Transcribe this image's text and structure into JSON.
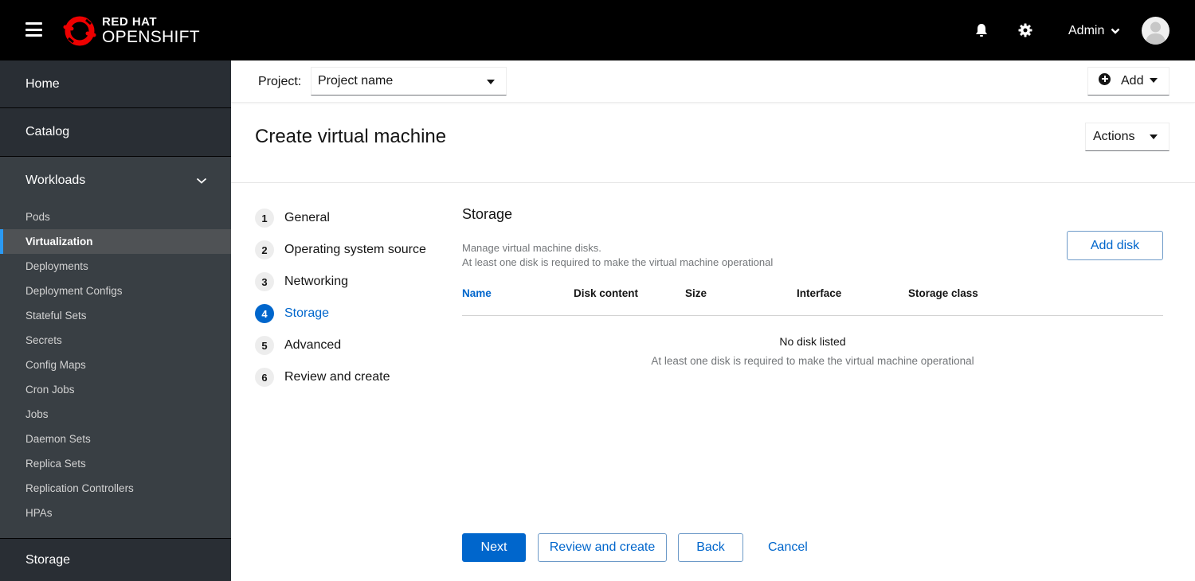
{
  "masthead": {
    "brand_line1": "RED HAT",
    "brand_line2": "OPENSHIFT",
    "user_label": "Admin",
    "icons": [
      "hamburger-icon",
      "openshift-logo-icon",
      "bell-icon",
      "gear-icon",
      "chevron-down-icon",
      "avatar-icon"
    ]
  },
  "sidebar": {
    "home": "Home",
    "catalog": "Catalog",
    "workloads": {
      "label": "Workloads",
      "expanded": true,
      "items": [
        {
          "label": "Pods",
          "active": false
        },
        {
          "label": "Virtualization",
          "active": true
        },
        {
          "label": "Deployments",
          "active": false
        },
        {
          "label": "Deployment Configs",
          "active": false
        },
        {
          "label": "Stateful Sets",
          "active": false
        },
        {
          "label": "Secrets",
          "active": false
        },
        {
          "label": "Config Maps",
          "active": false
        },
        {
          "label": "Cron Jobs",
          "active": false
        },
        {
          "label": "Jobs",
          "active": false
        },
        {
          "label": "Daemon Sets",
          "active": false
        },
        {
          "label": "Replica Sets",
          "active": false
        },
        {
          "label": "Replication Controllers",
          "active": false
        },
        {
          "label": "HPAs",
          "active": false
        }
      ]
    },
    "storage": "Storage"
  },
  "project_bar": {
    "label": "Project:",
    "selected": "Project name",
    "add_label": "Add"
  },
  "page": {
    "title": "Create virtual machine",
    "actions_label": "Actions"
  },
  "wizard": {
    "current_step": 4,
    "steps": [
      {
        "num": "1",
        "label": "General"
      },
      {
        "num": "2",
        "label": "Operating system source"
      },
      {
        "num": "3",
        "label": "Networking"
      },
      {
        "num": "4",
        "label": "Storage"
      },
      {
        "num": "5",
        "label": "Advanced"
      },
      {
        "num": "6",
        "label": "Review and create"
      }
    ]
  },
  "storage": {
    "title": "Storage",
    "desc_line1": "Manage virtual machine disks.",
    "desc_line2": "At least one disk is required to make the virtual machine operational",
    "add_disk_label": "Add disk",
    "columns": [
      "Name",
      "Disk content",
      "Size",
      "Interface",
      "Storage class"
    ],
    "sorted_column": "Name",
    "rows": [],
    "empty_title": "No disk listed",
    "empty_body": "At least one disk is required to make the virtual machine operational"
  },
  "footer": {
    "next": "Next",
    "review": "Review and create",
    "back": "Back",
    "cancel": "Cancel"
  },
  "colors": {
    "primary": "#0066cc",
    "masthead_bg": "#000000",
    "sidebar_bg": "#393f44",
    "sidebar_active_accent": "#2b9af3",
    "logo_red": "#ee0000"
  }
}
